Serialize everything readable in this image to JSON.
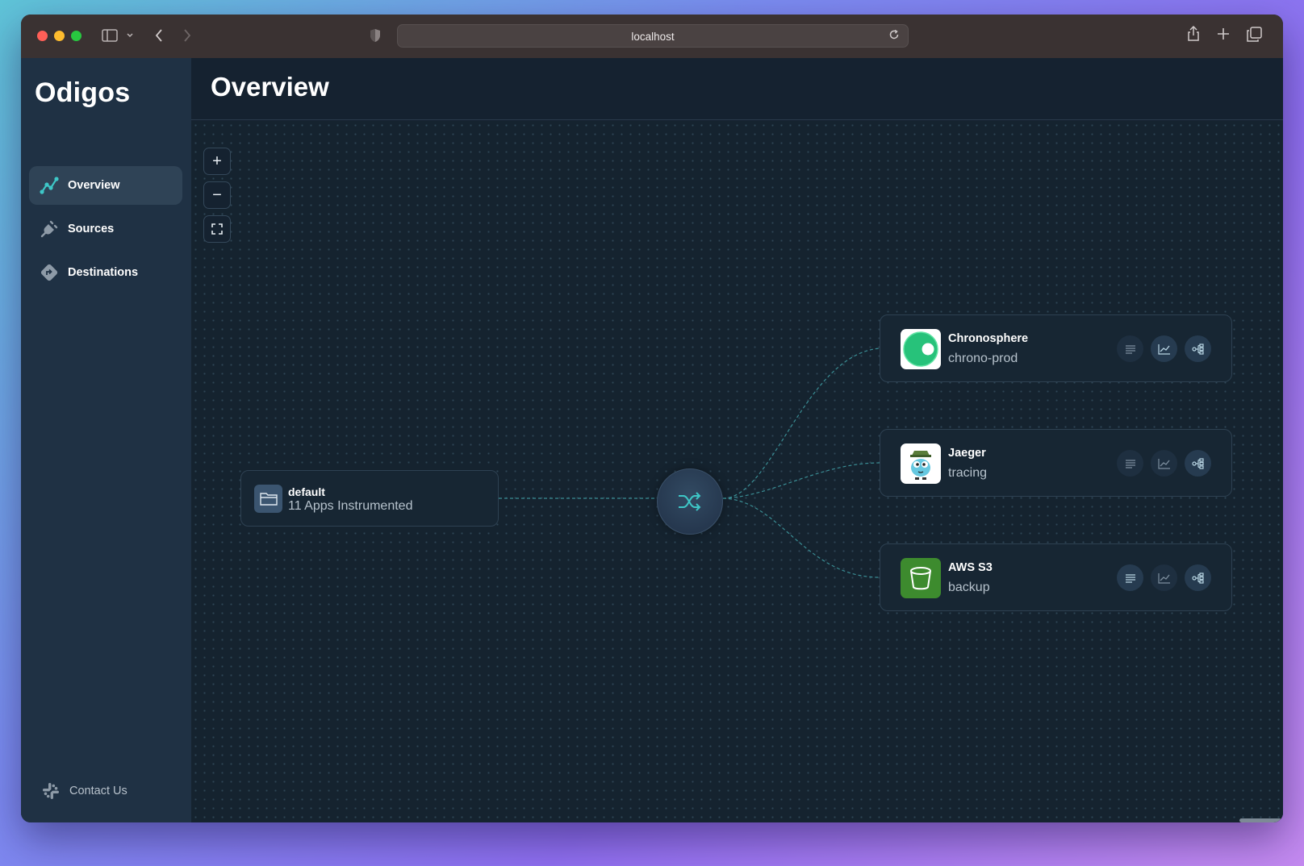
{
  "browser": {
    "url": "localhost",
    "traffic_colors": [
      "#ff5f57",
      "#febc2e",
      "#28c840"
    ]
  },
  "sidebar": {
    "logo": "Odigos",
    "items": [
      {
        "label": "Overview",
        "icon": "overview-chart-icon",
        "active": true
      },
      {
        "label": "Sources",
        "icon": "plug-icon",
        "active": false
      },
      {
        "label": "Destinations",
        "icon": "destination-diamond-icon",
        "active": false
      }
    ],
    "contact": "Contact Us"
  },
  "header": {
    "title": "Overview"
  },
  "canvas_controls": {
    "zoom_in": "+",
    "zoom_out": "−",
    "fit_view": "⛶"
  },
  "source": {
    "title": "default",
    "subtitle": "11 Apps Instrumented"
  },
  "destinations": [
    {
      "name": "Chronosphere",
      "id": "chrono-prod",
      "logo": "chronosphere-logo",
      "signals": {
        "logs": false,
        "metrics": true,
        "traces": true
      }
    },
    {
      "name": "Jaeger",
      "id": "tracing",
      "logo": "jaeger-logo",
      "signals": {
        "logs": false,
        "metrics": false,
        "traces": true
      }
    },
    {
      "name": "AWS S3",
      "id": "backup",
      "logo": "aws-s3-logo",
      "signals": {
        "logs": true,
        "metrics": false,
        "traces": true
      }
    }
  ],
  "colors": {
    "accent": "#3ec7c7",
    "edge": "#3a8d94"
  }
}
